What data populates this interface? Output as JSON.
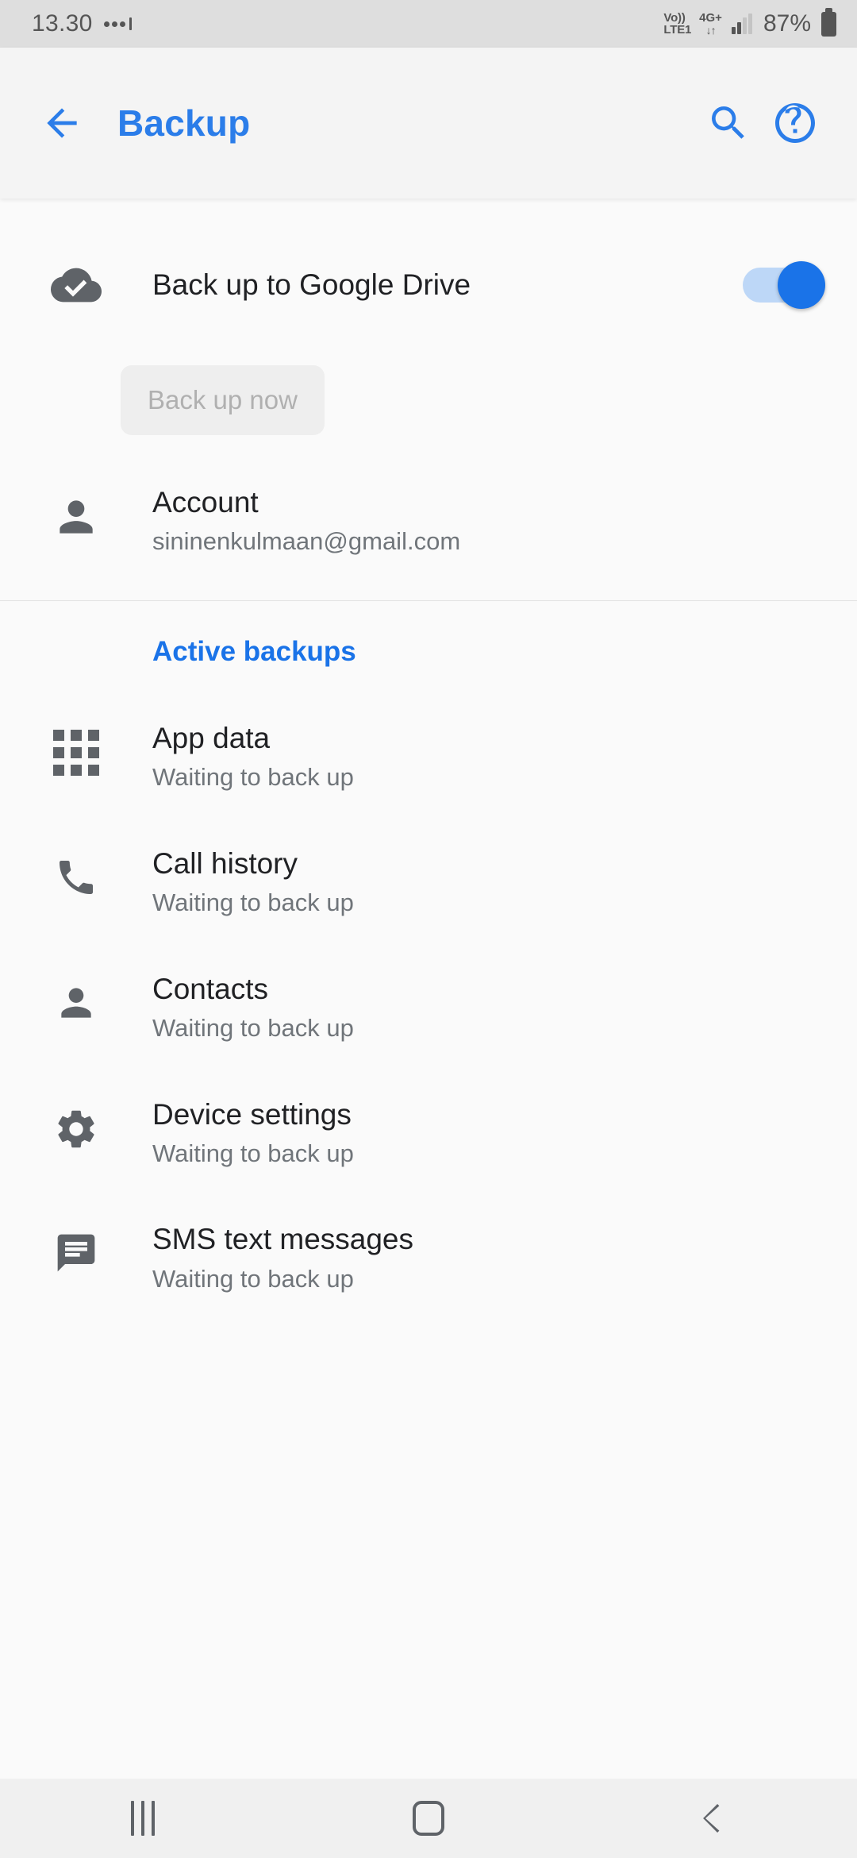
{
  "status_bar": {
    "clock": "13.30",
    "dots_icon": "more-dots-icon",
    "volte_top": "Vo))",
    "volte_bottom": "LTE1",
    "network_type": "4G+",
    "data_arrows": "↓↑",
    "battery_percent": "87%",
    "battery_icon": "battery-icon"
  },
  "app_bar": {
    "back_icon": "back-arrow-icon",
    "title": "Backup",
    "search_icon": "search-icon",
    "help_icon": "help-circle-icon",
    "accent_color": "#2b7de9"
  },
  "drive": {
    "icon": "cloud-check-icon",
    "label": "Back up to Google Drive",
    "toggle_state": "on",
    "toggle_color": "#1a73e8"
  },
  "backup_now": {
    "label": "Back up now",
    "enabled": false
  },
  "account": {
    "icon": "account-circle-icon",
    "title": "Account",
    "email": "sininenkulmaan@gmail.com"
  },
  "section": {
    "header": "Active backups",
    "header_color": "#1a73e8"
  },
  "backups": [
    {
      "icon": "apps-grid-icon",
      "title": "App data",
      "status": "Waiting to back up"
    },
    {
      "icon": "phone-icon",
      "title": "Call history",
      "status": "Waiting to back up"
    },
    {
      "icon": "person-icon",
      "title": "Contacts",
      "status": "Waiting to back up"
    },
    {
      "icon": "settings-gear-icon",
      "title": "Device settings",
      "status": "Waiting to back up"
    },
    {
      "icon": "message-icon",
      "title": "SMS text messages",
      "status": "Waiting to back up"
    }
  ],
  "nav_bar": {
    "recents_icon": "recents-icon",
    "home_icon": "home-icon",
    "back_icon": "nav-back-icon"
  }
}
